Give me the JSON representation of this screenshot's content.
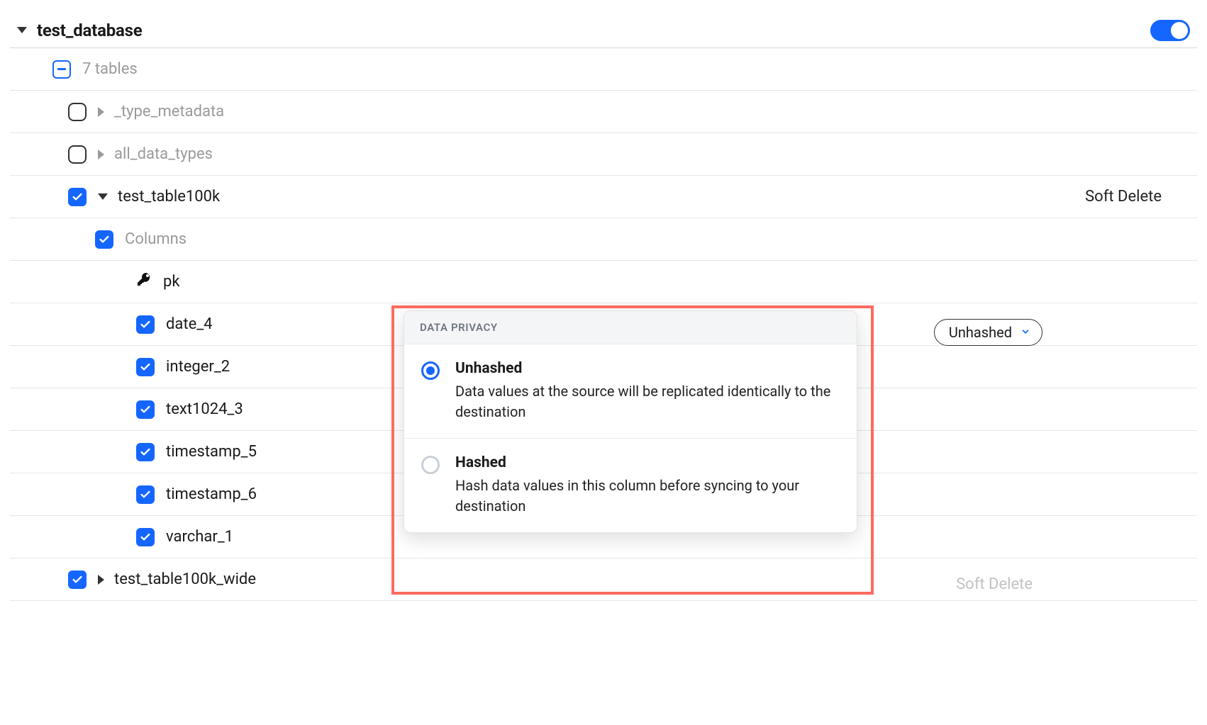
{
  "database": {
    "name": "test_database",
    "toggle_on": true
  },
  "tables_summary": "7 tables",
  "tables": [
    {
      "name": "_type_metadata",
      "muted": true
    },
    {
      "name": "all_data_types",
      "muted": true
    }
  ],
  "active_table": {
    "name": "test_table100k",
    "right_label": "Soft Delete",
    "columns_label": "Columns",
    "pk": "pk",
    "columns": [
      {
        "name": "date_4"
      },
      {
        "name": "integer_2"
      },
      {
        "name": "text1024_3"
      },
      {
        "name": "timestamp_5"
      },
      {
        "name": "timestamp_6"
      },
      {
        "name": "varchar_1"
      }
    ]
  },
  "bottom_table": {
    "name": "test_table100k_wide",
    "right_label_faded": "Soft Delete"
  },
  "privacy_dropdown": {
    "selected": "Unhashed",
    "header": "DATA PRIVACY",
    "options": [
      {
        "title": "Unhashed",
        "desc": "Data values at the source will be replicated identically to the destination",
        "selected": true
      },
      {
        "title": "Hashed",
        "desc": "Hash data values in this column before syncing to your destination",
        "selected": false
      }
    ]
  }
}
